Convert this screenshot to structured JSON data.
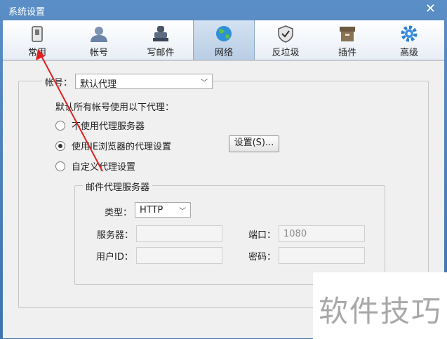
{
  "window": {
    "title": "系统设置",
    "close_glyph": "✕"
  },
  "toolbar": {
    "items": [
      {
        "label": "常用",
        "icon": "phone-icon"
      },
      {
        "label": "帐号",
        "icon": "user-icon"
      },
      {
        "label": "写邮件",
        "icon": "stamp-icon"
      },
      {
        "label": "网络",
        "icon": "globe-icon",
        "active": true
      },
      {
        "label": "反垃圾",
        "icon": "shield-icon"
      },
      {
        "label": "插件",
        "icon": "box-icon"
      },
      {
        "label": "高级",
        "icon": "gear-icon"
      }
    ]
  },
  "network": {
    "account_label": "帐号：",
    "account_proxy": "默认代理",
    "description": "默认所有帐号使用以下代理：",
    "options": [
      {
        "label": "不使用代理服务器",
        "checked": false
      },
      {
        "label": "使用IE浏览器的代理设置",
        "checked": true
      },
      {
        "label": "自定义代理设置",
        "checked": false
      }
    ],
    "settings_button": "设置(S)...",
    "mail_proxy_group": "邮件代理服务器",
    "type_label": "类型：",
    "type_value": "HTTP",
    "server_label": "服务器：",
    "server_value": "",
    "port_label": "端口：",
    "port_value": "1080",
    "user_label": "用户ID：",
    "user_value": "",
    "password_label": "密码：",
    "password_value": ""
  },
  "watermark": "软件技巧",
  "annotation_color": "#e02020"
}
